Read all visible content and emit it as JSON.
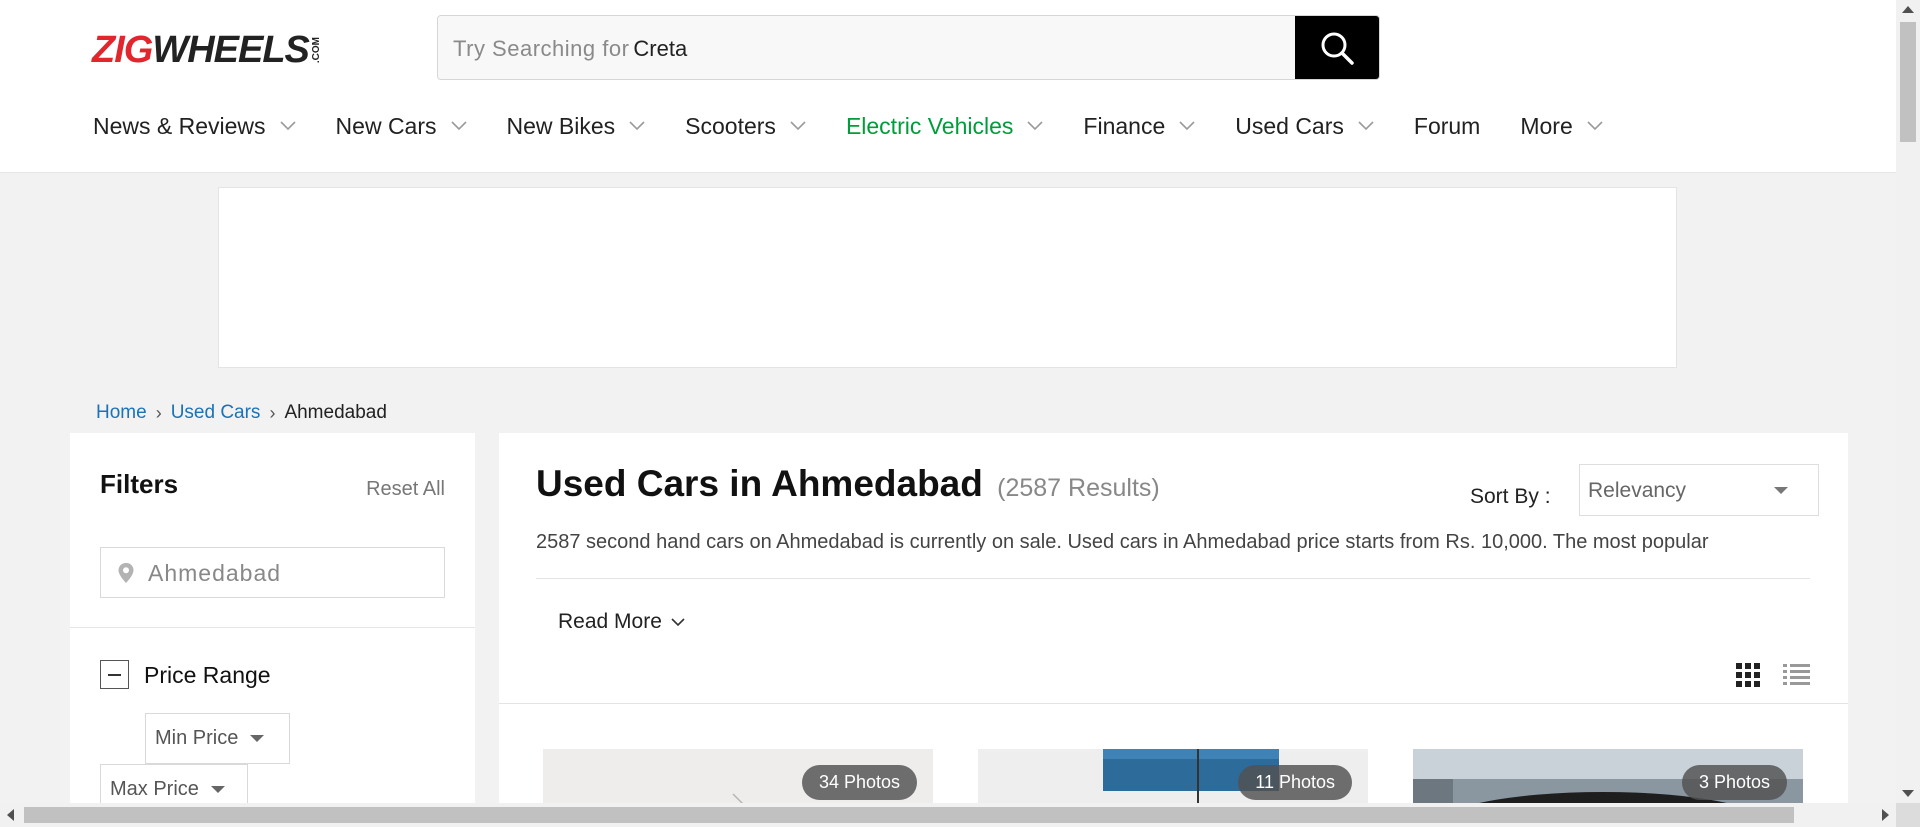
{
  "header": {
    "logo": {
      "part1": "ZIG",
      "part2": "WHEELS",
      "suffix": ".COM"
    },
    "search": {
      "placeholder": "Try Searching for",
      "hint": "Creta"
    },
    "nav": [
      {
        "label": "News & Reviews",
        "has_dropdown": true
      },
      {
        "label": "New Cars",
        "has_dropdown": true
      },
      {
        "label": "New Bikes",
        "has_dropdown": true
      },
      {
        "label": "Scooters",
        "has_dropdown": true
      },
      {
        "label": "Electric Vehicles",
        "has_dropdown": true,
        "highlight": true
      },
      {
        "label": "Finance",
        "has_dropdown": true
      },
      {
        "label": "Used Cars",
        "has_dropdown": true
      },
      {
        "label": "Forum",
        "has_dropdown": false
      },
      {
        "label": "More",
        "has_dropdown": true
      }
    ]
  },
  "breadcrumb": {
    "home": "Home",
    "used_cars": "Used Cars",
    "current": "Ahmedabad"
  },
  "filters": {
    "title": "Filters",
    "reset": "Reset All",
    "location": "Ahmedabad",
    "price_range": {
      "label": "Price Range",
      "min": "Min Price",
      "max": "Max Price"
    }
  },
  "main": {
    "title": "Used Cars in Ahmedabad",
    "results": "(2587 Results)",
    "sort_label": "Sort By :",
    "sort_value": "Relevancy",
    "description": "2587 second hand cars on Ahmedabad is currently on sale. Used cars in Ahmedabad price starts from Rs. 10,000. The most popular",
    "read_more": "Read More",
    "cards": [
      {
        "photos": "34 Photos"
      },
      {
        "photos": "11 Photos"
      },
      {
        "photos": "3 Photos"
      }
    ]
  },
  "colors": {
    "brand_red": "#e1262d",
    "ev_green": "#009d3a",
    "link_blue": "#1a73b8"
  }
}
